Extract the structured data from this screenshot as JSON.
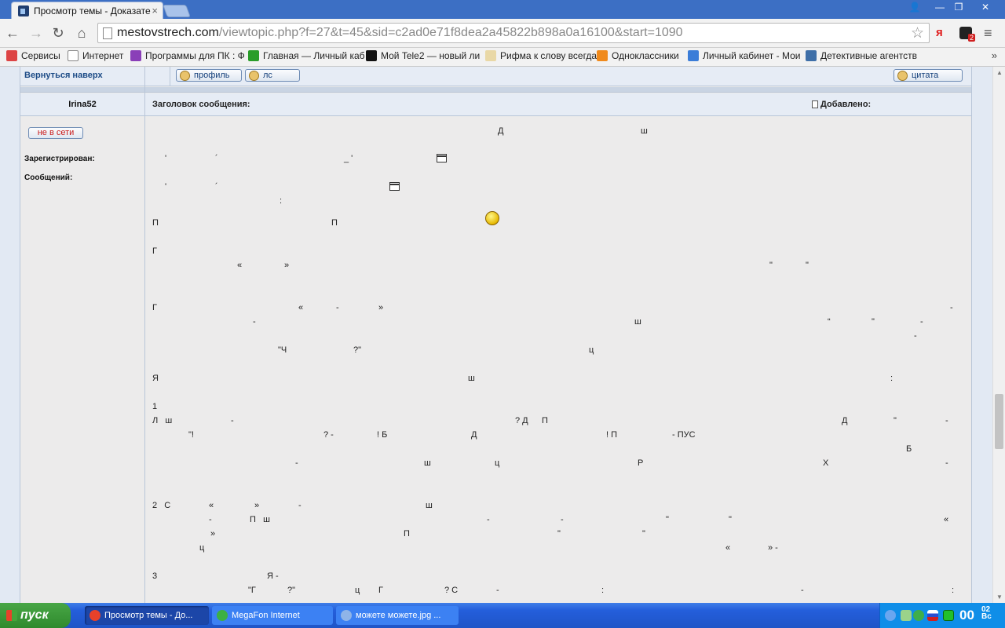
{
  "browser": {
    "tab_title": "Просмотр темы - Доказате",
    "tab_close": "×",
    "window_buttons": {
      "user": "👤",
      "minimize": "—",
      "maximize": "❐",
      "close": "✕"
    },
    "nav": {
      "back": "←",
      "forward": "→",
      "reload": "↻",
      "home": "⌂"
    },
    "url_host": "mestovstrech.com",
    "url_path": "/viewtopic.php?f=27&t=45&sid=c2ad0e71f8dea2a45822b898a0a16100&start=1090",
    "star": "☆",
    "ext_yandex": "я",
    "ext_badge": "2",
    "menu": "≡"
  },
  "bookmarks": {
    "items": [
      {
        "label": "Сервисы",
        "icon_color": "#d44"
      },
      {
        "label": "Интернет",
        "icon_color": "#ffffff"
      },
      {
        "label": "Программы для ПК : Ф",
        "icon_color": "#8a3fb8"
      },
      {
        "label": "Главная — Личный каб",
        "icon_color": "#2a9d2a"
      },
      {
        "label": "Мой Tele2 — новый ли",
        "icon_color": "#111111"
      },
      {
        "label": "Рифма к слову всегда",
        "icon_color": "#e9d8a6"
      },
      {
        "label": "Одноклассники",
        "icon_color": "#f08a1c"
      },
      {
        "label": "Личный кабинет - Мои",
        "icon_color": "#3b7dd8"
      },
      {
        "label": "Детективные агентств",
        "icon_color": "#3f6fa8"
      }
    ],
    "more": "»"
  },
  "forum": {
    "back_to_top": "Вернуться наверх",
    "profile_btn": "профиль",
    "ls_btn": "лс",
    "quote_btn": "цитата",
    "author": "Irina52",
    "subject_label": "Заголовок сообщения:",
    "added_label": "Добавлено:",
    "offline_btn": "не в сети",
    "registered_label": "Зарегистрирован:",
    "messages_label": "Сообщений:"
  },
  "message_fragments": [
    "Д",
    "ш",
    "'",
    "´",
    "_ '",
    "'",
    "´",
    ":",
    "П",
    "П",
    "Г",
    "«",
    "»",
    "\"",
    "\"",
    "Г",
    "«",
    "-",
    "»",
    "-",
    "-",
    "ш",
    "“",
    "\"",
    "-",
    "-",
    "\"Ч",
    "?\"",
    "ц",
    "Я",
    "ш",
    ":",
    "1",
    "Л   ш",
    "-",
    "? Д",
    "П",
    "Д",
    "\"",
    "-",
    "\"!",
    "? -",
    "! Б",
    "Д",
    "! П",
    "- ПУС",
    "Б",
    "-",
    "ш",
    "ц",
    "Р",
    "Х",
    "-",
    "2   С",
    "«",
    "»",
    "-",
    "ш",
    "-",
    "П   ш",
    "-",
    "-",
    "\"",
    "\"",
    "«",
    "»",
    "П",
    "\"",
    "\"",
    "ц",
    "«",
    "» -",
    "3",
    "Я -",
    "\"Г",
    "?\"",
    "ц",
    "Г",
    "? С",
    "-",
    ":",
    "-",
    ":"
  ],
  "scrollbar": {
    "position_fraction": 0.69
  },
  "taskbar": {
    "start_label": "пуск",
    "tasks": [
      {
        "label": "Просмотр темы - До...",
        "icon_color": "#e8412a"
      },
      {
        "label": "MegaFon Internet",
        "icon_color": "#3cb043"
      },
      {
        "label": "можете можете.jpg ...",
        "icon_color": "#8fb4e8"
      }
    ],
    "clock": "00",
    "clock_sub": "02",
    "clock_day": "Вс"
  }
}
